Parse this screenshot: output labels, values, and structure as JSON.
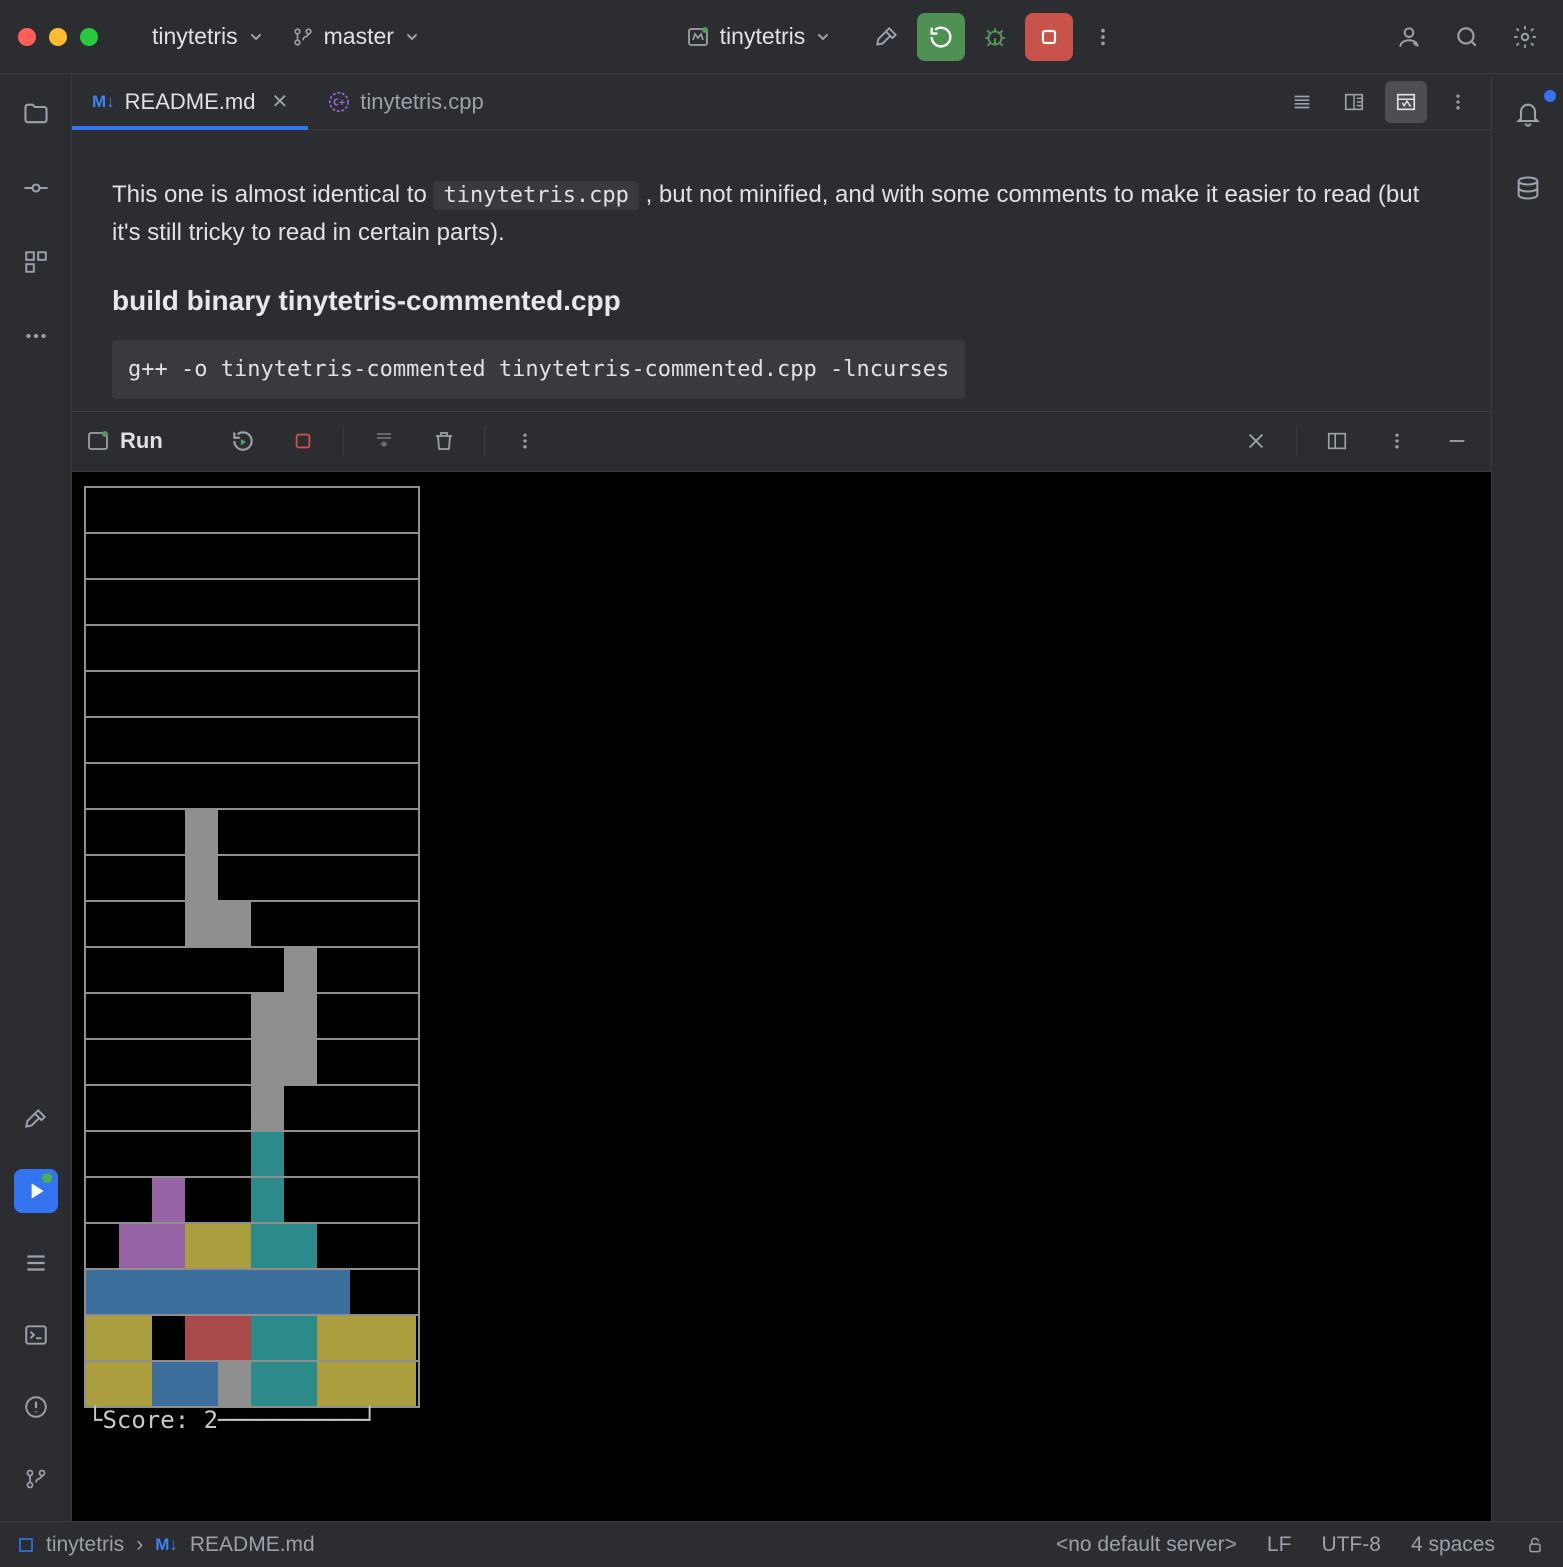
{
  "titlebar": {
    "project_name": "tinytetris",
    "branch": "master",
    "run_config": "tinytetris"
  },
  "tabs": [
    {
      "icon": "M↓",
      "label": "README.md",
      "active": true
    },
    {
      "icon": "cpp",
      "label": "tinytetris.cpp",
      "active": false
    }
  ],
  "editor": {
    "para_pre": "This one is almost identical to ",
    "para_code": "tinytetris.cpp",
    "para_post": " , but not minified, and with some comments to make it easier to read (but it's still tricky to read in certain parts).",
    "h2": "build binary tinytetris-commented.cpp",
    "cmd": "g++ -o tinytetris-commented tinytetris-commented.cpp -lncurses"
  },
  "run": {
    "label": "Run",
    "score_label": "Score:",
    "score_value": "2",
    "board": [
      "..........",
      "..........",
      "..........",
      "..........",
      "..........",
      "..........",
      "..........",
      "...g......",
      "...g......",
      "...gg.....",
      "......g...",
      ".....gg...",
      ".....gg...",
      ".....g....",
      ".....t....",
      "..p..t....",
      ".ppoott...",
      "bbbbbbbb..",
      "oo.rrttooo",
      "oobbgttooo"
    ]
  },
  "status": {
    "crumb_root": "tinytetris",
    "crumb_file": "README.md",
    "server": "<no default server>",
    "line_sep": "LF",
    "encoding": "UTF-8",
    "indent": "4 spaces"
  }
}
